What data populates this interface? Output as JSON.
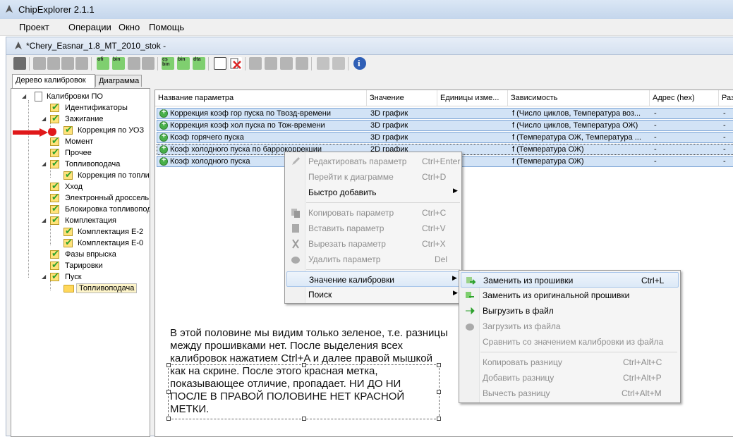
{
  "app": {
    "title": "ChipExplorer 2.1.1"
  },
  "menubar": [
    "Проект",
    "Операции",
    "Окно",
    "Помощь"
  ],
  "child": {
    "title": "*Chery_Easnar_1.8_MT_2010_stok -"
  },
  "toolbar": {
    "labels": [
      "ofi",
      "bin",
      "cs\nbin",
      "bin",
      "dta"
    ]
  },
  "tabs": [
    "Дерево калибровок",
    "Диаграмма"
  ],
  "tree": [
    "Калибровки ПО",
    "Идентификаторы",
    "Зажигание",
    "Коррекция по УОЗ",
    "Момент",
    "Прочее",
    "Топливоподача",
    "Коррекция по топлив",
    "Хход",
    "Электронный дроссель",
    "Блокировка топливопода",
    "Комплектация",
    "Комплектация Е-2",
    "Комплектация Е-0",
    "Фазы впрыска",
    "Тарировки",
    "Пуск",
    "Топливоподача"
  ],
  "table": {
    "columns": [
      "Название параметра",
      "Значение",
      "Единицы изме...",
      "Зависимость",
      "Адрес (hex)",
      "Раз"
    ],
    "rows": [
      [
        "Коррекция коэф гор пуска по Твозд-времени",
        "3D график",
        "",
        "f (Число циклов, Температура воз...",
        "-",
        "-"
      ],
      [
        "Коррекция коэф хол пуска по Тож-времени",
        "3D график",
        "",
        "f (Число циклов, Температура ОЖ)",
        "-",
        "-"
      ],
      [
        "Коэф горячего пуска",
        "3D график",
        "",
        "f (Температура ОЖ, Температура ...",
        "-",
        "-"
      ],
      [
        "Коэф холодного пуска по баррокоррекции",
        "2D график",
        "",
        "f (Температура ОЖ)",
        "-",
        "-"
      ],
      [
        "Коэф холодного пуска",
        "",
        "",
        "f (Температура ОЖ)",
        "-",
        "-"
      ]
    ]
  },
  "context_menu": {
    "items": [
      {
        "label": "Редактировать параметр",
        "shortcut": "Ctrl+Enter"
      },
      {
        "label": "Перейти к диаграмме",
        "shortcut": "Ctrl+D"
      },
      {
        "label": "Быстро добавить",
        "shortcut": ""
      },
      {
        "label": "Копировать параметр",
        "shortcut": "Ctrl+C"
      },
      {
        "label": "Вставить параметр",
        "shortcut": "Ctrl+V"
      },
      {
        "label": "Вырезать параметр",
        "shortcut": "Ctrl+X"
      },
      {
        "label": "Удалить параметр",
        "shortcut": "Del"
      },
      {
        "label": "Значение калибровки",
        "shortcut": ""
      },
      {
        "label": "Поиск",
        "shortcut": ""
      }
    ]
  },
  "submenu": {
    "items": [
      {
        "label": "Заменить из прошивки",
        "shortcut": "Ctrl+L"
      },
      {
        "label": "Заменить из оригинальной прошивки",
        "shortcut": ""
      },
      {
        "label": "Выгрузить в файл",
        "shortcut": ""
      },
      {
        "label": "Загрузить из файла",
        "shortcut": ""
      },
      {
        "label": "Сравнить со значением калибровки из файла",
        "shortcut": ""
      },
      {
        "label": "Копировать разницу",
        "shortcut": "Ctrl+Alt+C"
      },
      {
        "label": "Добавить разницу",
        "shortcut": "Ctrl+Alt+P"
      },
      {
        "label": "Вычесть разницу",
        "shortcut": "Ctrl+Alt+M"
      }
    ]
  },
  "note": {
    "lines": [
      "В этой половине мы видим только зеленое, т.е. разницы",
      "между прошивками нет. После выделения всех",
      "калибровок нажатием Ctrl+A и далее правой мышкой",
      "как на скрине. После этого красная метка,",
      "показывающее отличие, пропадает. НИ ДО НИ",
      "ПОСЛЕ В ПРАВОЙ ПОЛОВИНЕ НЕТ КРАСНОЙ",
      "МЕТКИ."
    ]
  },
  "colors": {
    "accent": "#d2e3f6",
    "check": "#2da12d",
    "marker": "#e0181a"
  }
}
